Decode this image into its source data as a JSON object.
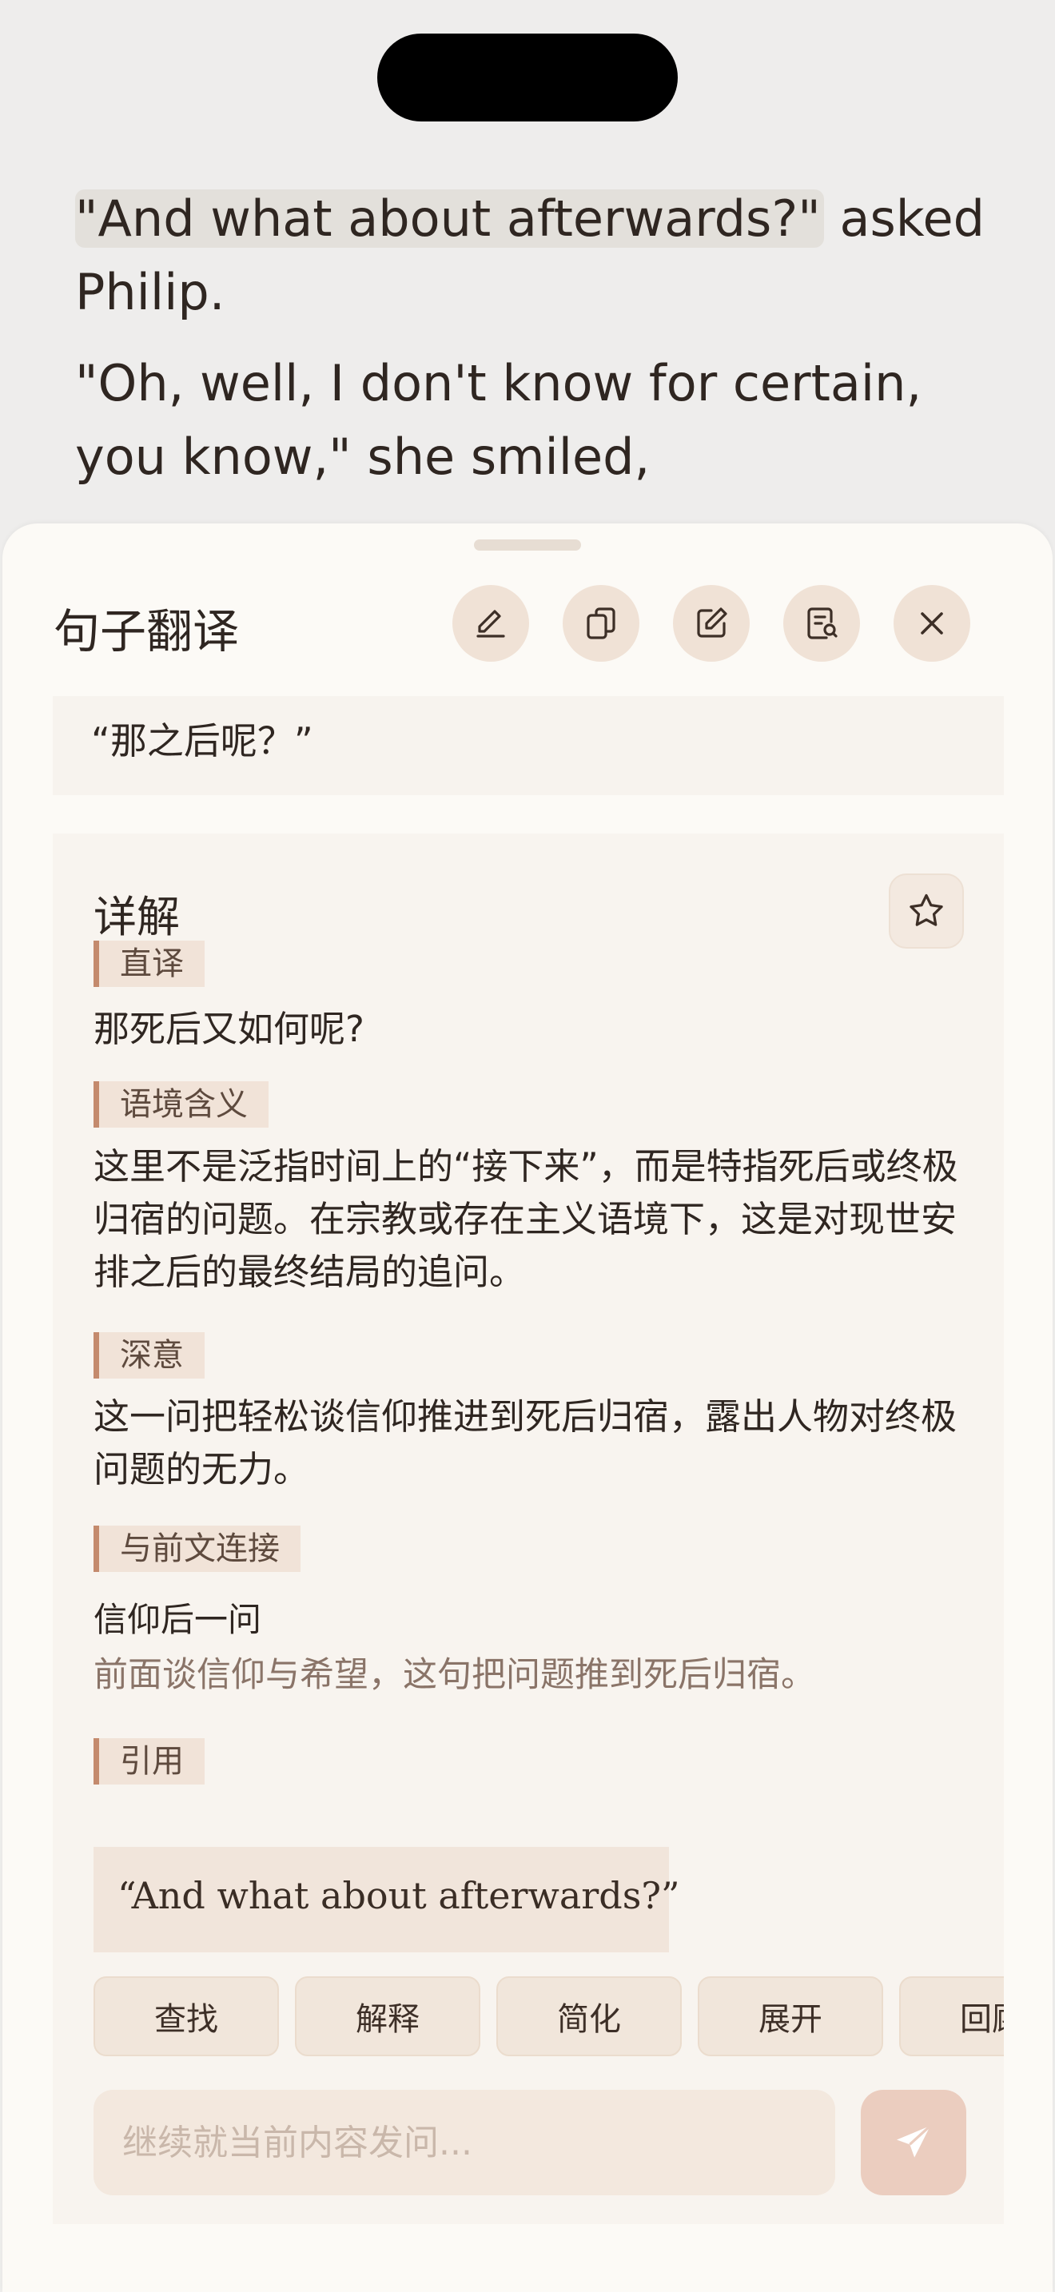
{
  "reader": {
    "line1_highlight": "\"And what about afterwards?\"",
    "line1_rest": " asked Philip.",
    "line2": "\"Oh, well, I don't know for certain, you know,\" she smiled,"
  },
  "sheet": {
    "title": "句子翻译",
    "toolbar": [
      {
        "name": "pencil-icon"
      },
      {
        "name": "copy-icon"
      },
      {
        "name": "edit-icon"
      },
      {
        "name": "search-document-icon"
      },
      {
        "name": "close-icon"
      }
    ],
    "translation": "“那之后呢？”",
    "detail": {
      "title": "详解",
      "literal_tag": "直译",
      "literal_text": "那死后又如何呢?",
      "context_tag": "语境含义",
      "context_text": "这里不是泛指时间上的“接下来”，而是特指死后或终极归宿的问题。在宗教或存在主义语境下，这是对现世安排之后的最终结局的追问。",
      "deep_tag": "深意",
      "deep_text": "这一问把轻松谈信仰推进到死后归宿，露出人物对终极问题的无力。",
      "link_tag": "与前文连接",
      "link_title": "信仰后一问",
      "link_desc": "前面谈信仰与希望，这句把问题推到死后归宿。",
      "quote_tag": "引用",
      "quote_text": "“And what about afterwards?”"
    },
    "chips": [
      "查找",
      "解释",
      "简化",
      "展开",
      "回顾"
    ],
    "input_placeholder": "继续就当前内容发问..."
  },
  "colors": {
    "accent": "#C48A6D",
    "sheet_bg": "#FCFAF6",
    "tool_bg": "#F0E2D6",
    "send_bg": "#EBCDBF"
  }
}
